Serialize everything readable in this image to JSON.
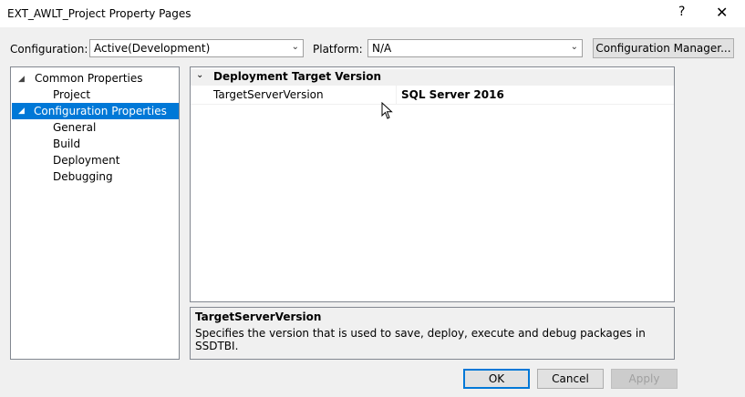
{
  "window": {
    "title": "EXT_AWLT_Project Property Pages",
    "help_glyph": "?",
    "close_glyph": "✕"
  },
  "config_bar": {
    "configuration_label": "Configuration:",
    "configuration_value": "Active(Development)",
    "platform_label": "Platform:",
    "platform_value": "N/A",
    "manager_button": "Configuration Manager..."
  },
  "tree": {
    "items": [
      {
        "label": "Common Properties",
        "level": 0,
        "expanded": true,
        "selected": false
      },
      {
        "label": "Project",
        "level": 1,
        "selected": false
      },
      {
        "label": "Configuration Properties",
        "level": 0,
        "expanded": true,
        "selected": true
      },
      {
        "label": "General",
        "level": 1,
        "selected": false
      },
      {
        "label": "Build",
        "level": 1,
        "selected": false
      },
      {
        "label": "Deployment",
        "level": 1,
        "selected": false
      },
      {
        "label": "Debugging",
        "level": 1,
        "selected": false
      }
    ]
  },
  "grid": {
    "category": "Deployment Target Version",
    "property_name": "TargetServerVersion",
    "property_value": "SQL Server 2016"
  },
  "description": {
    "title": "TargetServerVersion",
    "text": "Specifies the version that is used to save, deploy, execute and debug packages in SSDTBI."
  },
  "buttons": {
    "ok": "OK",
    "cancel": "Cancel",
    "apply": "Apply"
  },
  "colors": {
    "selection": "#0078d7",
    "dialog_bg": "#f0f0f0"
  }
}
